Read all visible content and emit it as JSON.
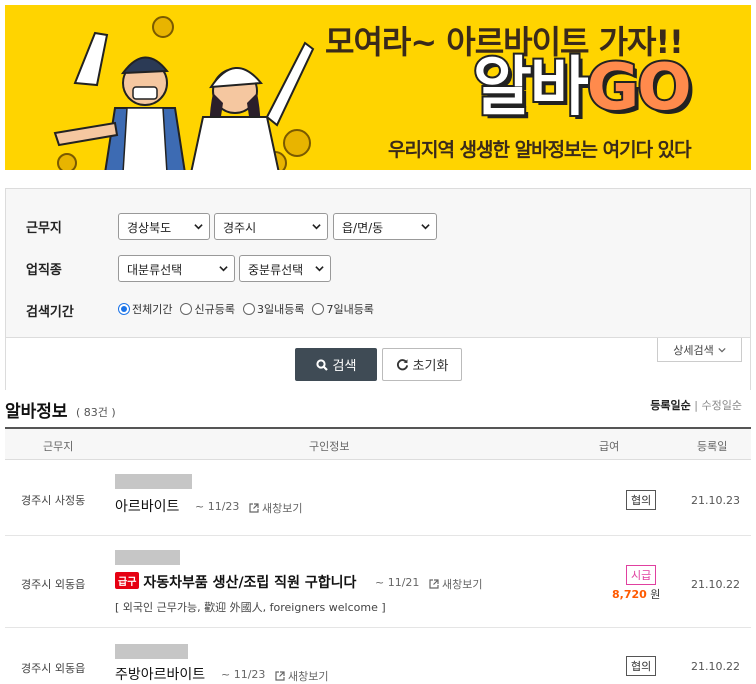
{
  "banner": {
    "headline": "모여라~ 아르바이트 가자!!",
    "logo_part1": "알바",
    "logo_part2": "GO",
    "tagline": "우리지역 생생한 알바정보는 여기다 있다"
  },
  "search": {
    "location_label": "근무지",
    "province_value": "경상북도",
    "city_value": "경주시",
    "district_value": "읍/면/동",
    "category_label": "업직종",
    "major_category_value": "대분류선택",
    "mid_category_value": "중분류선택",
    "period_label": "검색기간",
    "period_options": [
      "전체기간",
      "신규등록",
      "3일내등록",
      "7일내등록"
    ],
    "search_button": "검색",
    "reset_button": "초기화",
    "detail_button": "상세검색"
  },
  "listing": {
    "title": "알바정보",
    "count": "( 83건 )",
    "sort_registered": "등록일순",
    "sort_separator": "|",
    "sort_modified": "수정일순",
    "columns": {
      "location": "근무지",
      "job_info": "구인정보",
      "pay": "급여",
      "date": "등록일"
    },
    "rows": [
      {
        "location": "경주시 사정동",
        "title": "아르바이트",
        "due": "~ 11/23",
        "new_window": "새창보기",
        "pay_type": "협의",
        "date": "21.10.23"
      },
      {
        "location": "경주시 외동읍",
        "urgent": "급구",
        "title": "자동차부품 생산/조립 직원 구합니다",
        "due": "~ 11/21",
        "new_window": "새창보기",
        "subtext": "[ 외국인 근무가능, 歡迎 外國人, foreigners welcome ]",
        "pay_type": "시급",
        "wage_amount": "8,720",
        "wage_unit": "원",
        "date": "21.10.22"
      },
      {
        "location": "경주시 외동읍",
        "title": "주방아르바이트",
        "due": "~ 11/23",
        "new_window": "새창보기",
        "pay_type": "협의",
        "date": "21.10.22"
      }
    ]
  },
  "colors": {
    "banner_yellow": "#ffd400",
    "search_button": "#3f4b55",
    "urgent_red": "#e60012",
    "wage_orange": "#ff5a00",
    "hourly_badge": "#e040a0",
    "radio_blue": "#1a73e8"
  }
}
